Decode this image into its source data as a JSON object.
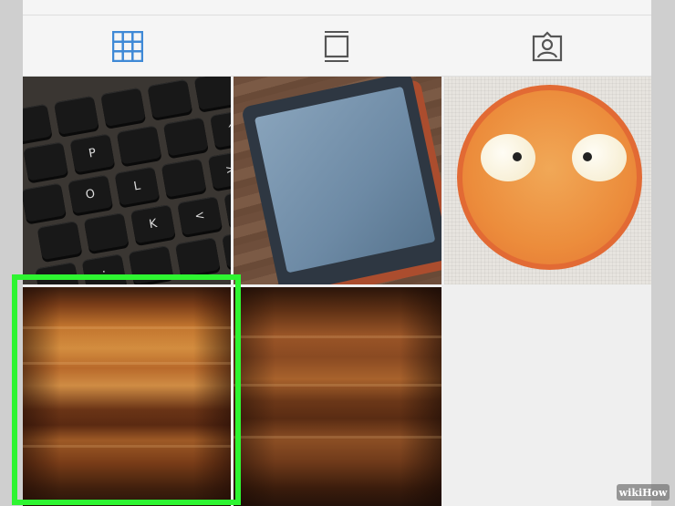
{
  "tabs": [
    {
      "icon": "grid-icon",
      "state": "active",
      "color": "#3f89d6"
    },
    {
      "icon": "feed-icon",
      "state": "inactive",
      "color": "#555555"
    },
    {
      "icon": "tagged-icon",
      "state": "inactive",
      "color": "#555555"
    }
  ],
  "posts": [
    {
      "subject": "keyboard-photo"
    },
    {
      "subject": "phone-photo"
    },
    {
      "subject": "emoji-photo"
    },
    {
      "subject": "wood-photo",
      "selected": true
    },
    {
      "subject": "wood-photo-2"
    }
  ],
  "keyboard_keys": [
    "P",
    "^",
    "O",
    "L",
    "K",
    "<",
    ">",
    ":"
  ],
  "selection_color": "#2ef531",
  "watermark": {
    "text": "wikiHow"
  }
}
